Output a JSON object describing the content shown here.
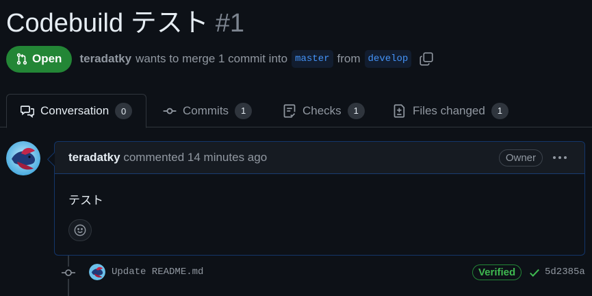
{
  "pr": {
    "title": "Codebuild テスト",
    "number": "#1",
    "state": "Open",
    "author": "teradatky",
    "merge_text": "wants to merge 1 commit into",
    "base_branch": "master",
    "from_text": "from",
    "head_branch": "develop"
  },
  "tabs": [
    {
      "label": "Conversation",
      "count": "0",
      "icon": "comment-discussion-icon"
    },
    {
      "label": "Commits",
      "count": "1",
      "icon": "git-commit-icon"
    },
    {
      "label": "Checks",
      "count": "1",
      "icon": "checklist-icon"
    },
    {
      "label": "Files changed",
      "count": "1",
      "icon": "file-diff-icon"
    }
  ],
  "comment": {
    "author": "teradatky",
    "action": "commented",
    "time": "14 minutes ago",
    "role_badge": "Owner",
    "body": "テスト"
  },
  "commit": {
    "message": "Update README.md",
    "verified_label": "Verified",
    "sha": "5d2385a"
  },
  "colors": {
    "background": "#0d1117",
    "open_green": "#238636",
    "branch_blue": "#4493f8",
    "verified_green": "#3fb950"
  }
}
